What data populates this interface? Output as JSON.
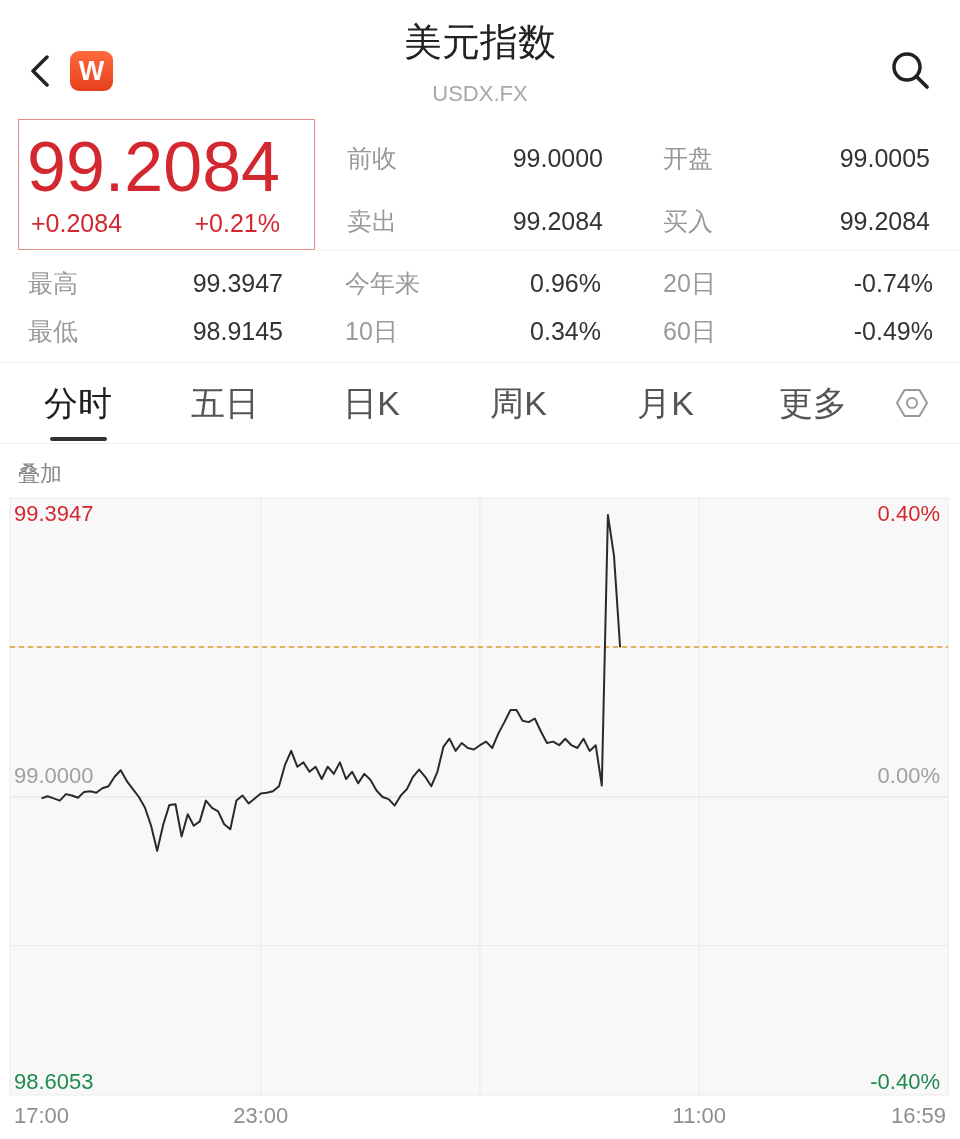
{
  "header": {
    "logo_text": "W",
    "title": "美元指数",
    "subtitle": "USDX.FX"
  },
  "quote": {
    "price": "99.2084",
    "change": "+0.2084",
    "change_percent": "+0.21%"
  },
  "stats_top": [
    {
      "label": "前收",
      "value": "99.0000"
    },
    {
      "label": "开盘",
      "value": "99.0005"
    },
    {
      "label": "卖出",
      "value": "99.2084"
    },
    {
      "label": "买入",
      "value": "99.2084"
    }
  ],
  "stats_bottom": [
    {
      "label": "最高",
      "value": "99.3947"
    },
    {
      "label": "今年来",
      "value": "0.96%"
    },
    {
      "label": "20日",
      "value": "-0.74%"
    },
    {
      "label": "最低",
      "value": "98.9145"
    },
    {
      "label": "10日",
      "value": "0.34%"
    },
    {
      "label": "60日",
      "value": "-0.49%"
    }
  ],
  "tabs": [
    {
      "label": "分时",
      "selected": true
    },
    {
      "label": "五日",
      "selected": false
    },
    {
      "label": "日K",
      "selected": false
    },
    {
      "label": "周K",
      "selected": false
    },
    {
      "label": "月K",
      "selected": false
    },
    {
      "label": "更多",
      "selected": false
    }
  ],
  "chart": {
    "overlay_label": "叠加",
    "percent_labels": [
      "0.40%",
      "0.00%",
      "-0.40%"
    ],
    "chart_data": {
      "type": "line",
      "categories": [
        "17:00",
        null,
        null,
        null,
        null,
        null,
        null,
        null,
        null,
        null,
        null,
        null,
        null,
        null,
        null,
        null,
        null,
        null,
        null,
        null,
        null,
        null,
        null,
        null,
        null,
        null,
        null,
        null,
        null,
        null,
        null,
        null,
        null,
        null,
        null,
        null,
        "23:00",
        null,
        null,
        null,
        null,
        null,
        null,
        null,
        null,
        null,
        null,
        null,
        null,
        null,
        null,
        null,
        null,
        null,
        null,
        null,
        null,
        null,
        null,
        null,
        null,
        null,
        null,
        null,
        null,
        null,
        null,
        null,
        null,
        null,
        null,
        null,
        null,
        null,
        null,
        null,
        null,
        null,
        null,
        null,
        null,
        null,
        null,
        null,
        null,
        null,
        null,
        null,
        null,
        null,
        null,
        null,
        null,
        null,
        null,
        null,
        null,
        null,
        null,
        null,
        null,
        null,
        null,
        null,
        null,
        null,
        null,
        null,
        "11:00",
        null,
        null,
        null,
        null,
        null,
        null,
        null,
        null,
        null,
        null,
        null,
        null,
        null,
        null,
        null,
        null,
        null,
        null,
        null,
        null,
        null,
        null,
        null,
        null,
        null,
        null,
        null,
        null,
        null,
        null,
        null,
        null,
        null,
        null,
        null,
        "16:59"
      ],
      "series": [
        {
          "color": "#2a2a2a",
          "values": [
            98.998,
            99.001,
            98.998,
            98.995,
            99.004,
            99.002,
            98.999,
            99.007,
            99.008,
            99.006,
            99.012,
            99.015,
            99.028,
            99.037,
            99.022,
            99.011,
            99.0,
            98.985,
            98.96,
            98.925,
            98.962,
            98.989,
            98.99,
            98.945,
            98.976,
            98.96,
            98.966,
            98.995,
            98.985,
            98.98,
            98.962,
            98.955,
            98.995,
            99.002,
            98.991,
            98.998,
            99.005,
            99.006,
            99.008,
            99.015,
            99.045,
            99.064,
            99.042,
            99.048,
            99.035,
            99.042,
            99.025,
            99.042,
            99.032,
            99.048,
            99.025,
            99.035,
            99.019,
            99.032,
            99.024,
            99.009,
            99.0,
            98.997,
            98.988,
            99.002,
            99.011,
            99.028,
            99.038,
            99.028,
            99.015,
            99.035,
            99.07,
            99.081,
            99.064,
            99.075,
            99.068,
            99.066,
            99.072,
            99.077,
            99.068,
            99.088,
            99.104,
            99.121,
            99.121,
            99.106,
            99.104,
            99.109,
            99.091,
            99.075,
            99.077,
            99.072,
            99.081,
            99.072,
            99.068,
            99.081,
            99.064,
            99.072,
            99.016,
            99.392,
            99.335,
            99.208,
            null,
            null,
            null,
            null,
            null,
            null,
            null,
            null,
            null,
            null,
            null,
            null,
            null,
            null,
            null,
            null,
            null,
            null,
            null,
            null,
            null,
            null,
            null,
            null,
            null,
            null,
            null,
            null,
            null,
            null,
            null,
            null,
            null,
            null,
            null,
            null,
            null,
            null,
            null,
            null,
            null,
            null,
            null,
            null,
            null,
            null,
            null,
            null,
            null
          ]
        }
      ],
      "ylim": [
        98.5858,
        99.4155
      ],
      "yticks": [
        {
          "value": 99.3947,
          "label": "99.3947"
        },
        {
          "value": 98.6053,
          "label": "98.6053"
        }
      ],
      "ref_lines": [
        {
          "axis": "y",
          "value": 99.2084,
          "color": "#e39a2d"
        },
        {
          "axis": "y",
          "value": 99.0,
          "label": "99.0000",
          "color": "#e6e6e6"
        }
      ]
    }
  }
}
